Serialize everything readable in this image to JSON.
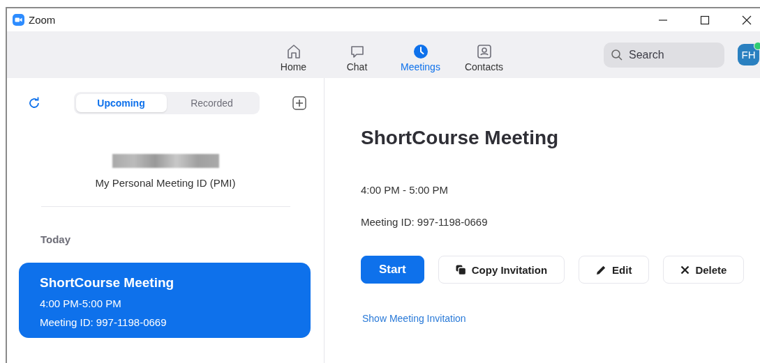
{
  "window": {
    "title": "Zoom"
  },
  "nav": [
    {
      "label": "Home",
      "kind": "home",
      "selected": false
    },
    {
      "label": "Chat",
      "kind": "chat",
      "selected": false
    },
    {
      "label": "Meetings",
      "kind": "meetings",
      "selected": true
    },
    {
      "label": "Contacts",
      "kind": "contacts",
      "selected": false
    }
  ],
  "search": {
    "placeholder": "Search"
  },
  "avatar": {
    "initials": "FH",
    "online": true
  },
  "tabs": [
    {
      "label": "Upcoming",
      "selected": true
    },
    {
      "label": "Recorded",
      "selected": false
    }
  ],
  "pmi": {
    "label": "My Personal Meeting ID (PMI)"
  },
  "section": "Today",
  "meetings": [
    {
      "title": "ShortCourse Meeting",
      "time": "4:00 PM-5:00 PM",
      "id": "Meeting ID: 997-1198-0669",
      "selected": true
    }
  ],
  "detail": {
    "title": "ShortCourse Meeting",
    "time": "4:00 PM - 5:00 PM",
    "id": "Meeting ID: 997-1198-0669",
    "buttons": [
      {
        "label": "Start",
        "kind": "primary"
      },
      {
        "label": "Copy Invitation",
        "kind": "copy"
      },
      {
        "label": "Edit",
        "kind": "edit"
      },
      {
        "label": "Delete",
        "kind": "delete"
      }
    ],
    "link": "Show Meeting Invitation"
  }
}
